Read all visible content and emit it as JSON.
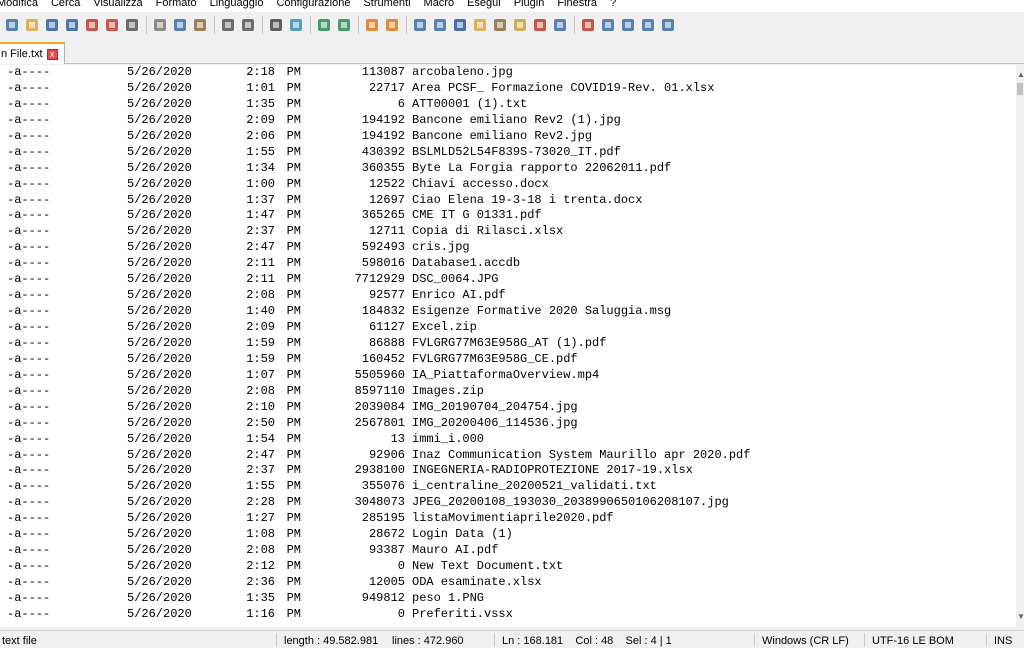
{
  "menu": [
    "Modifica",
    "Cerca",
    "Visualizza",
    "Formato",
    "Linguaggio",
    "Configurazione",
    "Strumenti",
    "Macro",
    "Esegui",
    "Plugin",
    "Finestra",
    "?"
  ],
  "toolbar_icons": [
    "new-file-icon",
    "open-file-icon",
    "save-icon",
    "save-all-icon",
    "close-icon",
    "close-all-icon",
    "print-icon",
    "cut-icon",
    "copy-icon",
    "paste-icon",
    "undo-icon",
    "redo-icon",
    "find-icon",
    "replace-icon",
    "zoom-in-icon",
    "zoom-out-icon",
    "sync-vertical-icon",
    "sync-horizontal-icon",
    "word-wrap-icon",
    "show-all-chars-icon",
    "indent-guide-icon",
    "doc-map-icon",
    "function-list-icon",
    "folder-workspace-icon",
    "document-list-icon",
    "monitor-icon",
    "record-macro-icon",
    "stop-macro-icon",
    "play-macro-icon",
    "run-macro-multiple-icon",
    "save-macro-icon"
  ],
  "tab": {
    "label": "n File.txt",
    "close": "x"
  },
  "rows": [
    [
      "-a----",
      "5/26/2020",
      "2:18",
      "PM",
      "113087",
      "arcobaleno.jpg"
    ],
    [
      "-a----",
      "5/26/2020",
      "1:01",
      "PM",
      "22717",
      "Area PCSF_ Formazione COVID19-Rev. 01.xlsx"
    ],
    [
      "-a----",
      "5/26/2020",
      "1:35",
      "PM",
      "6",
      "ATT00001 (1).txt"
    ],
    [
      "-a----",
      "5/26/2020",
      "2:09",
      "PM",
      "194192",
      "Bancone emiliano Rev2 (1).jpg"
    ],
    [
      "-a----",
      "5/26/2020",
      "2:06",
      "PM",
      "194192",
      "Bancone emiliano Rev2.jpg"
    ],
    [
      "-a----",
      "5/26/2020",
      "1:55",
      "PM",
      "430392",
      "BSLMLD52L54F839S-73020_IT.pdf"
    ],
    [
      "-a----",
      "5/26/2020",
      "1:34",
      "PM",
      "360355",
      "Byte La Forgia rapporto 22062011.pdf"
    ],
    [
      "-a----",
      "5/26/2020",
      "1:00",
      "PM",
      "12522",
      "Chiavi accesso.docx"
    ],
    [
      "-a----",
      "5/26/2020",
      "1:37",
      "PM",
      "12697",
      "Ciao Elena 19-3-18 i trenta.docx"
    ],
    [
      "-a----",
      "5/26/2020",
      "1:47",
      "PM",
      "365265",
      "CME IT G 01331.pdf"
    ],
    [
      "-a----",
      "5/26/2020",
      "2:37",
      "PM",
      "12711",
      "Copia di Rilasci.xlsx"
    ],
    [
      "-a----",
      "5/26/2020",
      "2:47",
      "PM",
      "592493",
      "cris.jpg"
    ],
    [
      "-a----",
      "5/26/2020",
      "2:11",
      "PM",
      "598016",
      "Database1.accdb"
    ],
    [
      "-a----",
      "5/26/2020",
      "2:11",
      "PM",
      "7712929",
      "DSC_0064.JPG"
    ],
    [
      "-a----",
      "5/26/2020",
      "2:08",
      "PM",
      "92577",
      "Enrico AI.pdf"
    ],
    [
      "-a----",
      "5/26/2020",
      "1:40",
      "PM",
      "184832",
      "Esigenze Formative 2020 Saluggia.msg"
    ],
    [
      "-a----",
      "5/26/2020",
      "2:09",
      "PM",
      "61127",
      "Excel.zip"
    ],
    [
      "-a----",
      "5/26/2020",
      "1:59",
      "PM",
      "86888",
      "FVLGRG77M63E958G_AT (1).pdf"
    ],
    [
      "-a----",
      "5/26/2020",
      "1:59",
      "PM",
      "160452",
      "FVLGRG77M63E958G_CE.pdf"
    ],
    [
      "-a----",
      "5/26/2020",
      "1:07",
      "PM",
      "5505960",
      "IA_PiattaformaOverview.mp4"
    ],
    [
      "-a----",
      "5/26/2020",
      "2:08",
      "PM",
      "8597110",
      "Images.zip"
    ],
    [
      "-a----",
      "5/26/2020",
      "2:10",
      "PM",
      "2039084",
      "IMG_20190704_204754.jpg"
    ],
    [
      "-a----",
      "5/26/2020",
      "2:50",
      "PM",
      "2567801",
      "IMG_20200406_114536.jpg"
    ],
    [
      "-a----",
      "5/26/2020",
      "1:54",
      "PM",
      "13",
      "immi_i.000"
    ],
    [
      "-a----",
      "5/26/2020",
      "2:47",
      "PM",
      "92906",
      "Inaz Communication System Maurillo apr 2020.pdf"
    ],
    [
      "-a----",
      "5/26/2020",
      "2:37",
      "PM",
      "2938100",
      "INGEGNERIA-RADIOPROTEZIONE 2017-19.xlsx"
    ],
    [
      "-a----",
      "5/26/2020",
      "1:55",
      "PM",
      "355076",
      "i_centraline_20200521_validati.txt"
    ],
    [
      "-a----",
      "5/26/2020",
      "2:28",
      "PM",
      "3048073",
      "JPEG_20200108_193030_2038990650106208107.jpg"
    ],
    [
      "-a----",
      "5/26/2020",
      "1:27",
      "PM",
      "285195",
      "listaMovimentiaprile2020.pdf"
    ],
    [
      "-a----",
      "5/26/2020",
      "1:08",
      "PM",
      "28672",
      "Login Data (1)"
    ],
    [
      "-a----",
      "5/26/2020",
      "2:08",
      "PM",
      "93387",
      "Mauro AI.pdf"
    ],
    [
      "-a----",
      "5/26/2020",
      "2:12",
      "PM",
      "0",
      "New Text Document.txt"
    ],
    [
      "-a----",
      "5/26/2020",
      "2:36",
      "PM",
      "12005",
      "ODA esaminate.xlsx"
    ],
    [
      "-a----",
      "5/26/2020",
      "1:35",
      "PM",
      "949812",
      "peso 1.PNG"
    ],
    [
      "-a----",
      "5/26/2020",
      "1:16",
      "PM",
      "0",
      "Preferiti.vssx"
    ]
  ],
  "status": {
    "file_type": "text file",
    "length": "length : 49.582.981",
    "lines": "lines : 472.960",
    "position": "Ln : 168.181    Col : 48    Sel : 4 | 1",
    "eol": "Windows (CR LF)",
    "encoding": "UTF-16 LE BOM",
    "mode": "INS"
  },
  "colors": {
    "tab_accent": "#f5a623",
    "close_red": "#e84a4a"
  }
}
